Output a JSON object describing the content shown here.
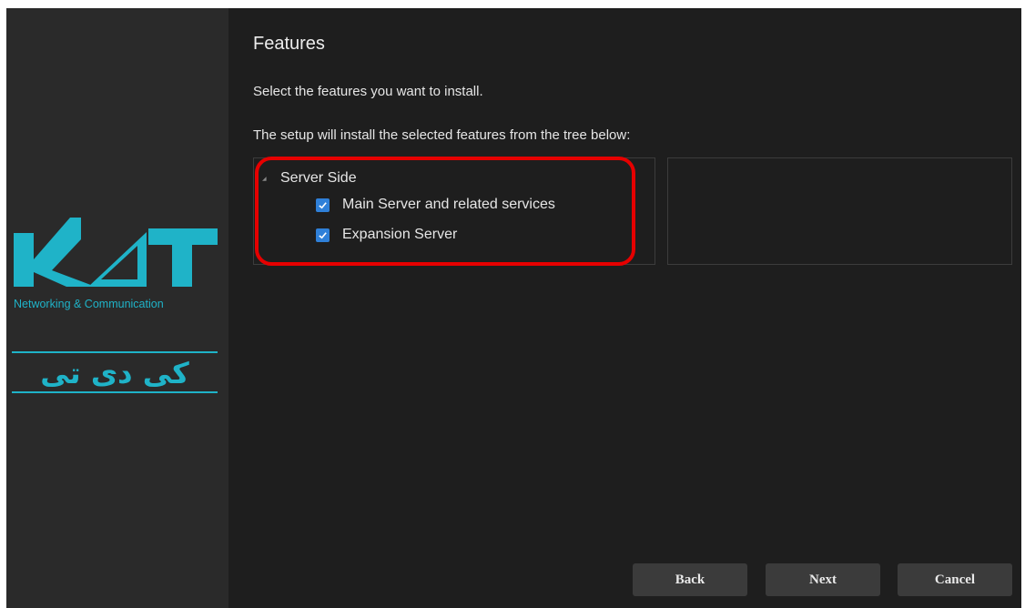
{
  "sidebar": {
    "brand_tagline": "Networking & Communication",
    "brand_name_fa": "کی دی تی",
    "brand_color": "#1fb3c8"
  },
  "page": {
    "title": "Features",
    "subtitle": "Select the features you want to install.",
    "instruction": "The setup will install the selected features from the tree below:"
  },
  "tree": {
    "root": {
      "label": "Server Side",
      "icon": "expander-arrow-icon"
    },
    "children": [
      {
        "label": "Main Server and related services",
        "checked": true
      },
      {
        "label": "Expansion Server",
        "checked": true
      }
    ]
  },
  "buttons": {
    "back": "Back",
    "next": "Next",
    "cancel": "Cancel"
  },
  "colors": {
    "background": "#1e1e1e",
    "sidebar": "#2a2a2a",
    "checkbox": "#2f80d8",
    "highlight": "#e60000"
  }
}
